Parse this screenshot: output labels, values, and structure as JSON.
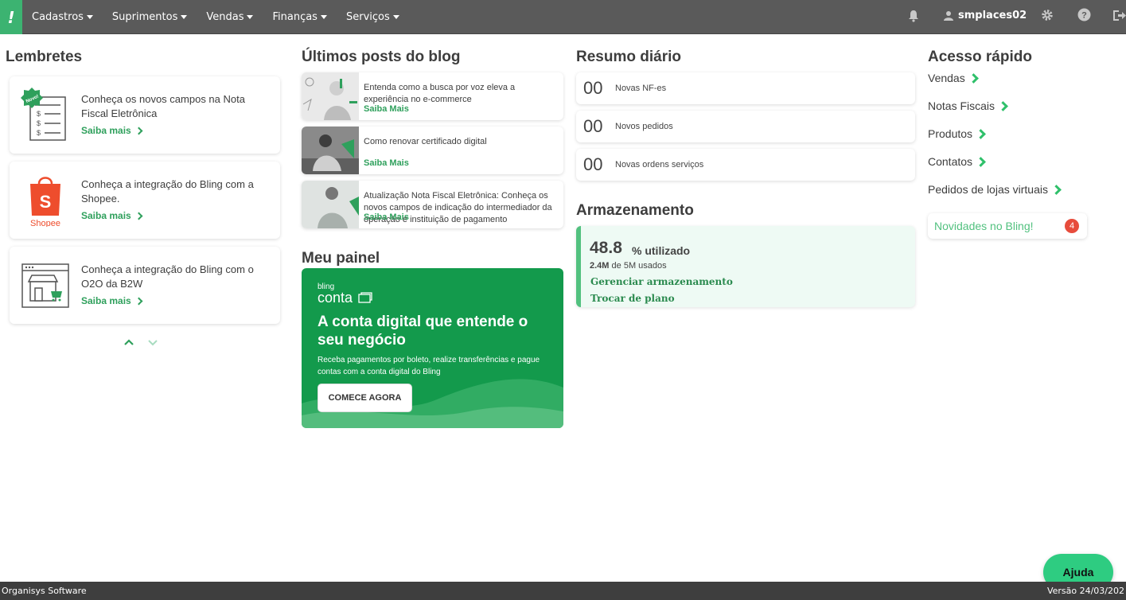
{
  "topbar": {
    "logo": "!",
    "menu": [
      {
        "label": "Cadastros"
      },
      {
        "label": "Suprimentos"
      },
      {
        "label": "Vendas"
      },
      {
        "label": "Finanças"
      },
      {
        "label": "Serviços"
      }
    ],
    "username": "smplaces02"
  },
  "lembretes": {
    "title": "Lembretes",
    "items": [
      {
        "text": "Conheça os novos campos na Nota Fiscal Eletrônica",
        "link": "Saiba mais",
        "badge": "Novo!",
        "icon": "invoice-icon"
      },
      {
        "text": "Conheça a integração do Bling com a Shopee.",
        "link": "Saiba mais",
        "icon": "shopee-icon",
        "icon_label": "Shopee"
      },
      {
        "text": "Conheça a integração do Bling com o O2O da B2W",
        "link": "Saiba mais",
        "icon": "storefront-icon"
      }
    ]
  },
  "blog": {
    "title": "Últimos posts do blog",
    "posts": [
      {
        "text": "Entenda como a busca por voz eleva a experiência no e-commerce",
        "link": "Saiba Mais"
      },
      {
        "text": "Como renovar certificado digital",
        "link": "Saiba Mais"
      },
      {
        "text": "Atualização Nota Fiscal Eletrônica: Conheça os novos campos de indicação do intermediador da operação e instituição de pagamento",
        "link": "Saiba Mais"
      }
    ]
  },
  "painel": {
    "title": "Meu painel",
    "banner": {
      "brand_small": "bling",
      "brand": "conta",
      "headline": "A conta digital que entende o seu negócio",
      "subtext": "Receba pagamentos por boleto, realize transferências e pague contas com a conta digital do Bling",
      "button": "COMECE AGORA"
    }
  },
  "resumo": {
    "title": "Resumo diário",
    "items": [
      {
        "count": "00",
        "label": "Novas NF-es"
      },
      {
        "count": "00",
        "label": "Novos pedidos"
      },
      {
        "count": "00",
        "label": "Novas ordens serviços"
      }
    ]
  },
  "armazenamento": {
    "title": "Armazenamento",
    "used_value": "48.8",
    "used_suffix": "% utilizado",
    "used_amount": "2.4M",
    "used_of": "de 5M usados",
    "link_manage": "Gerenciar armazenamento",
    "link_plan": "Trocar de plano"
  },
  "acesso": {
    "title": "Acesso rápido",
    "links": [
      {
        "label": "Vendas"
      },
      {
        "label": "Notas Fiscais"
      },
      {
        "label": "Produtos"
      },
      {
        "label": "Contatos"
      },
      {
        "label": "Pedidos de lojas virtuais"
      }
    ],
    "novidades": "Novidades no Bling!",
    "novidades_count": "4"
  },
  "ajuda": "Ajuda",
  "footer": {
    "left": "Organisys Software",
    "right": "Versão 24/03/202"
  },
  "colors": {
    "accent": "#2fa05c",
    "topbar": "#5a5a5a",
    "footer": "#3e3e3e",
    "badge": "#e74c3c"
  }
}
